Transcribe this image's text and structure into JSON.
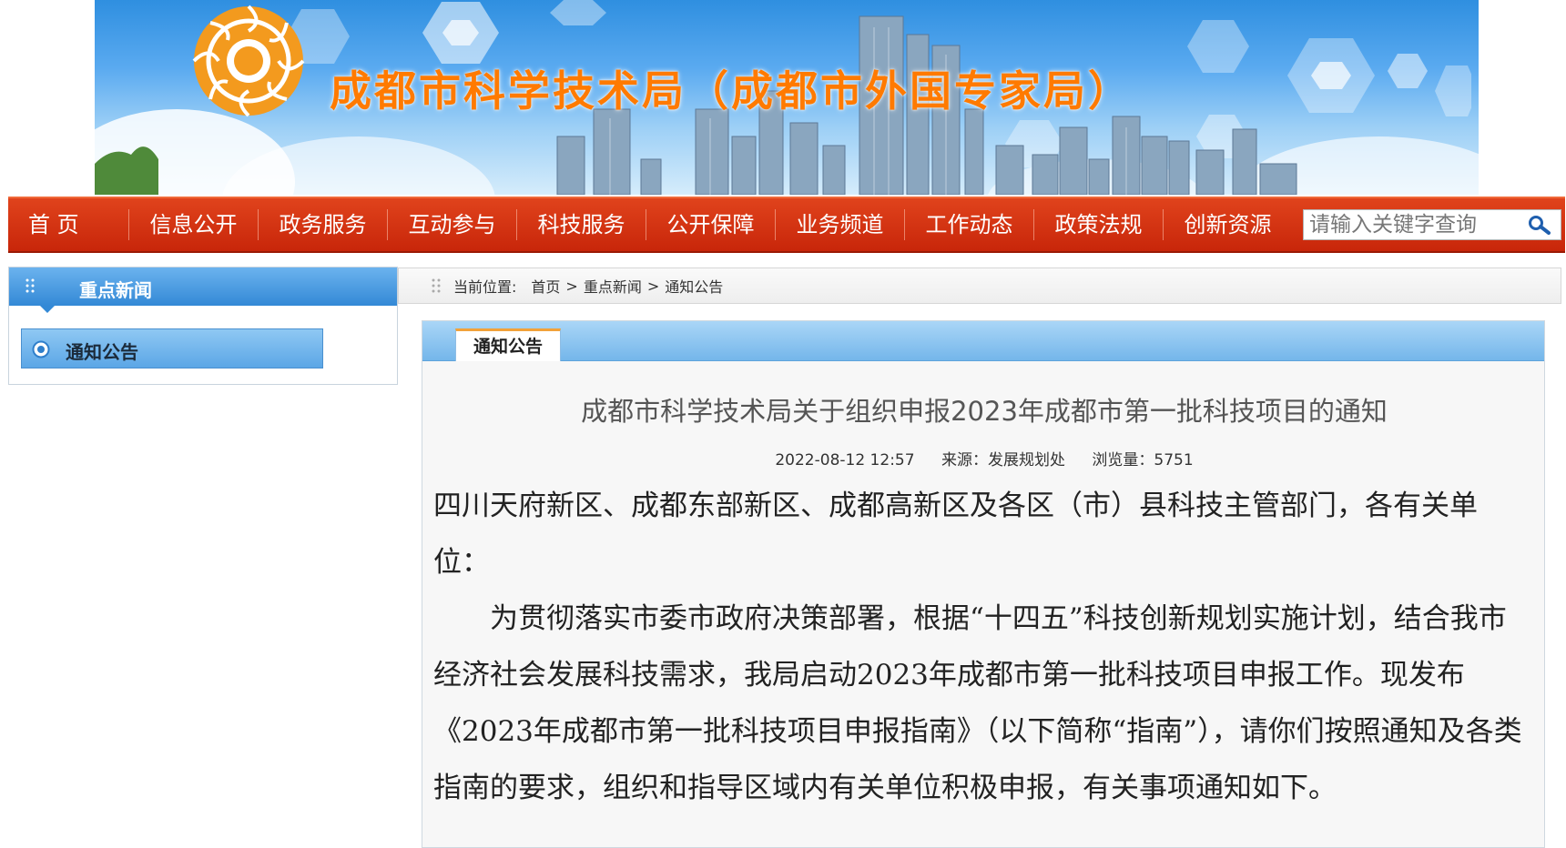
{
  "header": {
    "site_title": "成都市科学技术局（成都市外国专家局）",
    "colors": {
      "title": "#ff7a00",
      "nav_bg": "#d5320f",
      "accent_blue": "#3389d6"
    }
  },
  "nav": {
    "items": [
      "首 页",
      "信息公开",
      "政务服务",
      "互动参与",
      "科技服务",
      "公开保障",
      "业务频道",
      "工作动态",
      "政策法规",
      "创新资源"
    ],
    "search_placeholder": "请输入关键字查询"
  },
  "sidebar": {
    "heading": "重点新闻",
    "items": [
      {
        "label": "通知公告",
        "selected": true
      }
    ]
  },
  "breadcrumb": {
    "prefix": "当前位置:",
    "items": [
      "首页",
      "重点新闻",
      "通知公告"
    ],
    "separator": ">"
  },
  "article": {
    "tab_label": "通知公告",
    "title": "成都市科学技术局关于组织申报2023年成都市第一批科技项目的通知",
    "date": "2022-08-12 12:57",
    "source": "来源：发展规划处",
    "views": "浏览量：5751",
    "salutation": "四川天府新区、成都东部新区、成都高新区及各区（市）县科技主管部门，各有关单位：",
    "paragraph_1": "为贯彻落实市委市政府决策部署，根据“十四五”科技创新规划实施计划，结合我市经济社会发展科技需求，我局启动2023年成都市第一批科技项目申报工作。现发布《2023年成都市第一批科技项目申报指南》（以下简称“指南”），请你们按照通知及各类指南的要求，组织和指导区域内有关单位积极申报，有关事项通知如下。"
  }
}
